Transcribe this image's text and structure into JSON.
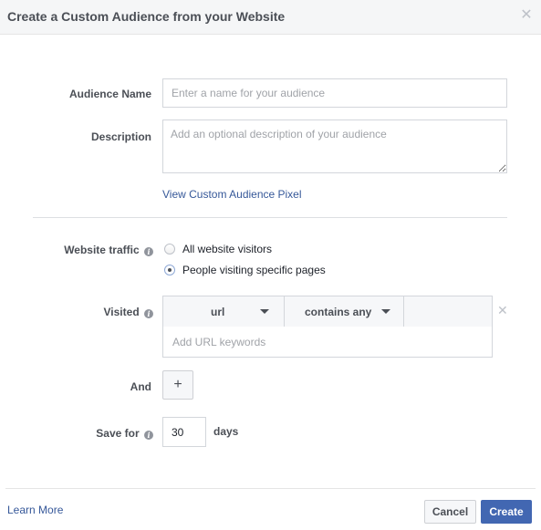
{
  "dialog": {
    "title": "Create a Custom Audience from your Website",
    "close_icon": "close-x-icon"
  },
  "form": {
    "audience_name": {
      "label": "Audience Name",
      "value": "",
      "placeholder": "Enter a name for your audience"
    },
    "description": {
      "label": "Description",
      "value": "",
      "placeholder": "Add an optional description of your audience"
    },
    "pixel_link": "View Custom Audience Pixel",
    "website_traffic": {
      "label": "Website traffic",
      "info_icon": "info-icon",
      "options": [
        {
          "label": "All website visitors",
          "selected": false
        },
        {
          "label": "People visiting specific pages",
          "selected": true
        }
      ]
    },
    "visited": {
      "label": "Visited",
      "info_icon": "info-icon",
      "field_select": "url",
      "operator_select": "contains any",
      "keywords_value": "",
      "keywords_placeholder": "Add URL keywords",
      "remove_icon": "close-x-icon"
    },
    "and": {
      "label": "And",
      "add_button": "+"
    },
    "save_for": {
      "label": "Save for",
      "info_icon": "info-icon",
      "value": "30",
      "unit": "days"
    }
  },
  "footer": {
    "learn_more": "Learn More",
    "cancel": "Cancel",
    "create": "Create"
  },
  "colors": {
    "primary": "#4267b2",
    "link": "#365899",
    "header_bg": "#f5f6f7",
    "label": "#4b4f56"
  }
}
